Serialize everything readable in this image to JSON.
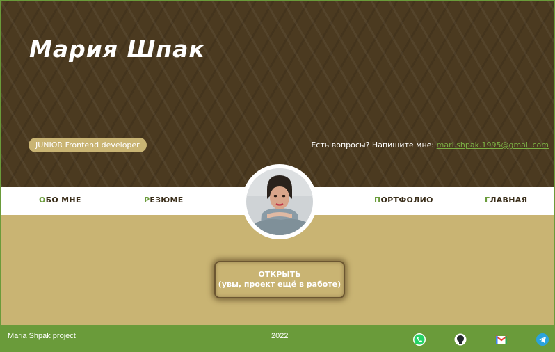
{
  "header": {
    "title": "Мария Шпак",
    "role_badge": "JUNIOR Frontend developer",
    "contact_prompt": "Есть вопросы? Напишите мне:",
    "contact_email": "mari.shpak.1995@gmail.com"
  },
  "nav": {
    "items": [
      {
        "first": "О",
        "rest": "БО МНЕ"
      },
      {
        "first": "Р",
        "rest": "ЕЗЮМЕ"
      },
      {
        "first": "П",
        "rest": "ОРТФОЛИО"
      },
      {
        "first": "Г",
        "rest": "ЛАВНАЯ"
      }
    ]
  },
  "main": {
    "button_line1": "ОТКРЫТЬ",
    "button_line2": "(увы, проект ещё в работе)"
  },
  "footer": {
    "project": "Maria Shpak project",
    "year": "2022",
    "social_icons": [
      "whatsapp-icon",
      "github-icon",
      "gmail-icon",
      "telegram-icon"
    ]
  },
  "colors": {
    "header_bg": "#4b3a20",
    "badge_bg": "#c9b473",
    "accent_green": "#6a9b3a",
    "main_bg": "#c9b473"
  }
}
